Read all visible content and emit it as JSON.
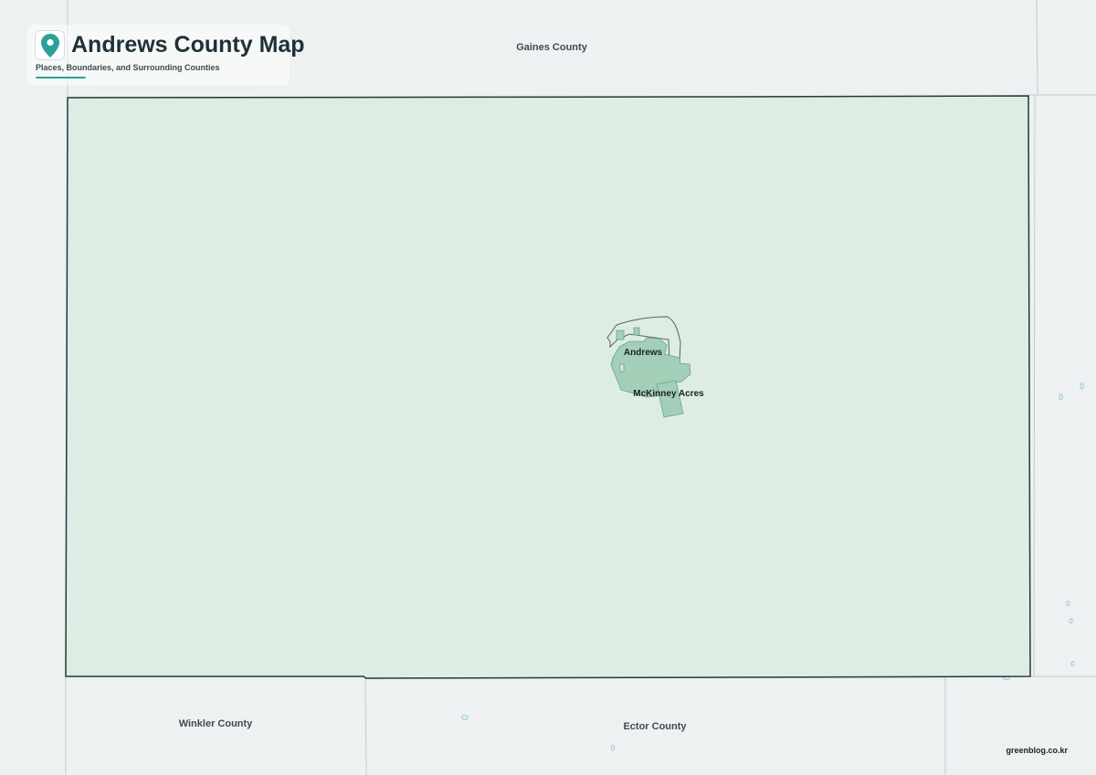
{
  "map": {
    "title": "Andrews County Map",
    "subtitle": "Places, Boundaries, and Surrounding Counties",
    "icon": "location-pin-icon",
    "counties": {
      "north": "Gaines County",
      "southwest": "Winkler County",
      "south": "Ector County"
    },
    "places": {
      "city": "Andrews",
      "cdp": "McKinney Acres"
    },
    "credit": "greenblog.co.kr"
  },
  "colors": {
    "background": "#eef1f2",
    "county_fill": "#ddede4",
    "county_border": "#1e3a3a",
    "place_fill": "#a3cfb9",
    "accent": "#2aa198",
    "neighbor_lines": "#c3c9cc",
    "water": "#8ecae6"
  }
}
